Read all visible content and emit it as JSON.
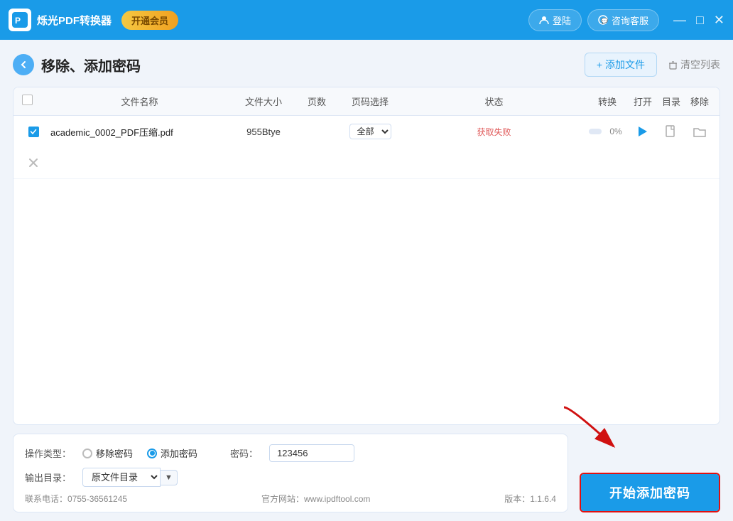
{
  "titlebar": {
    "logo_text": "烁光PDF转换器",
    "vip_button": "开通会员",
    "login_button": "登陆",
    "support_button": "咨询客服",
    "min_button": "—",
    "max_button": "□",
    "close_button": "✕"
  },
  "page": {
    "back_button": "←",
    "title": "移除、添加密码",
    "add_file_button": "+ 添加文件",
    "clear_list_button": "清空列表"
  },
  "table": {
    "headers": [
      "",
      "文件名称",
      "文件大小",
      "页数",
      "页码选择",
      "状态",
      "转换",
      "打开",
      "目录",
      "移除"
    ],
    "rows": [
      {
        "checked": true,
        "filename": "academic_0002_PDF压缩.pdf",
        "filesize": "955Btye",
        "pages": "",
        "page_select": "全部",
        "status": "获取失败",
        "progress": 0,
        "progress_text": "0%"
      }
    ]
  },
  "bottom": {
    "operation_type_label": "操作类型：",
    "remove_password_label": "移除密码",
    "add_password_label": "添加密码",
    "password_label": "密码：",
    "password_value": "123456",
    "output_dir_label": "输出目录：",
    "output_dir_value": "原文件目录",
    "start_button": "开始添加密码"
  },
  "footer": {
    "phone": "联系电话：0755-36561245",
    "website": "官方网站：www.ipdftool.com",
    "version": "版本：1.1.6.4"
  }
}
